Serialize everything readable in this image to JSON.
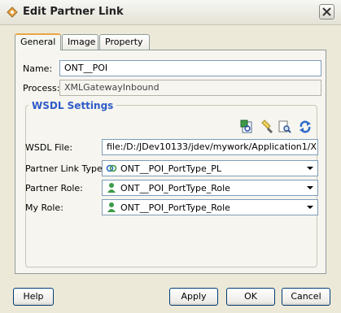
{
  "window": {
    "title": "Edit Partner Link",
    "close_icon": "close-icon"
  },
  "tabs": [
    {
      "label": "General",
      "active": true
    },
    {
      "label": "Image",
      "active": false
    },
    {
      "label": "Property",
      "active": false
    }
  ],
  "general": {
    "name_label": "Name:",
    "name_value": "ONT__POI",
    "process_label": "Process:",
    "process_value": "XMLGatewayInbound"
  },
  "wsdl": {
    "section_title": "WSDL Settings",
    "toolbar_icons": [
      "wsdl-browse-icon",
      "flashlight-icon",
      "find-icon",
      "refresh-icon"
    ],
    "file_label": "WSDL File:",
    "file_value": "file:/D:/JDev10133/jdev/mywork/Application1/XMLGat",
    "link_type_label": "Partner Link Type:",
    "link_type_value": "ONT__POI_PortType_PL",
    "partner_role_label": "Partner Role:",
    "partner_role_value": "ONT__POI_PortType_Role",
    "my_role_label": "My Role:",
    "my_role_value": "ONT__POI_PortType_Role"
  },
  "buttons": {
    "help": "Help",
    "apply": "Apply",
    "ok": "OK",
    "cancel": "Cancel"
  },
  "colors": {
    "section_title": "#2E5BC9",
    "tab_highlight": "#E9A645",
    "dialog_bg": "#ECE9D8"
  }
}
